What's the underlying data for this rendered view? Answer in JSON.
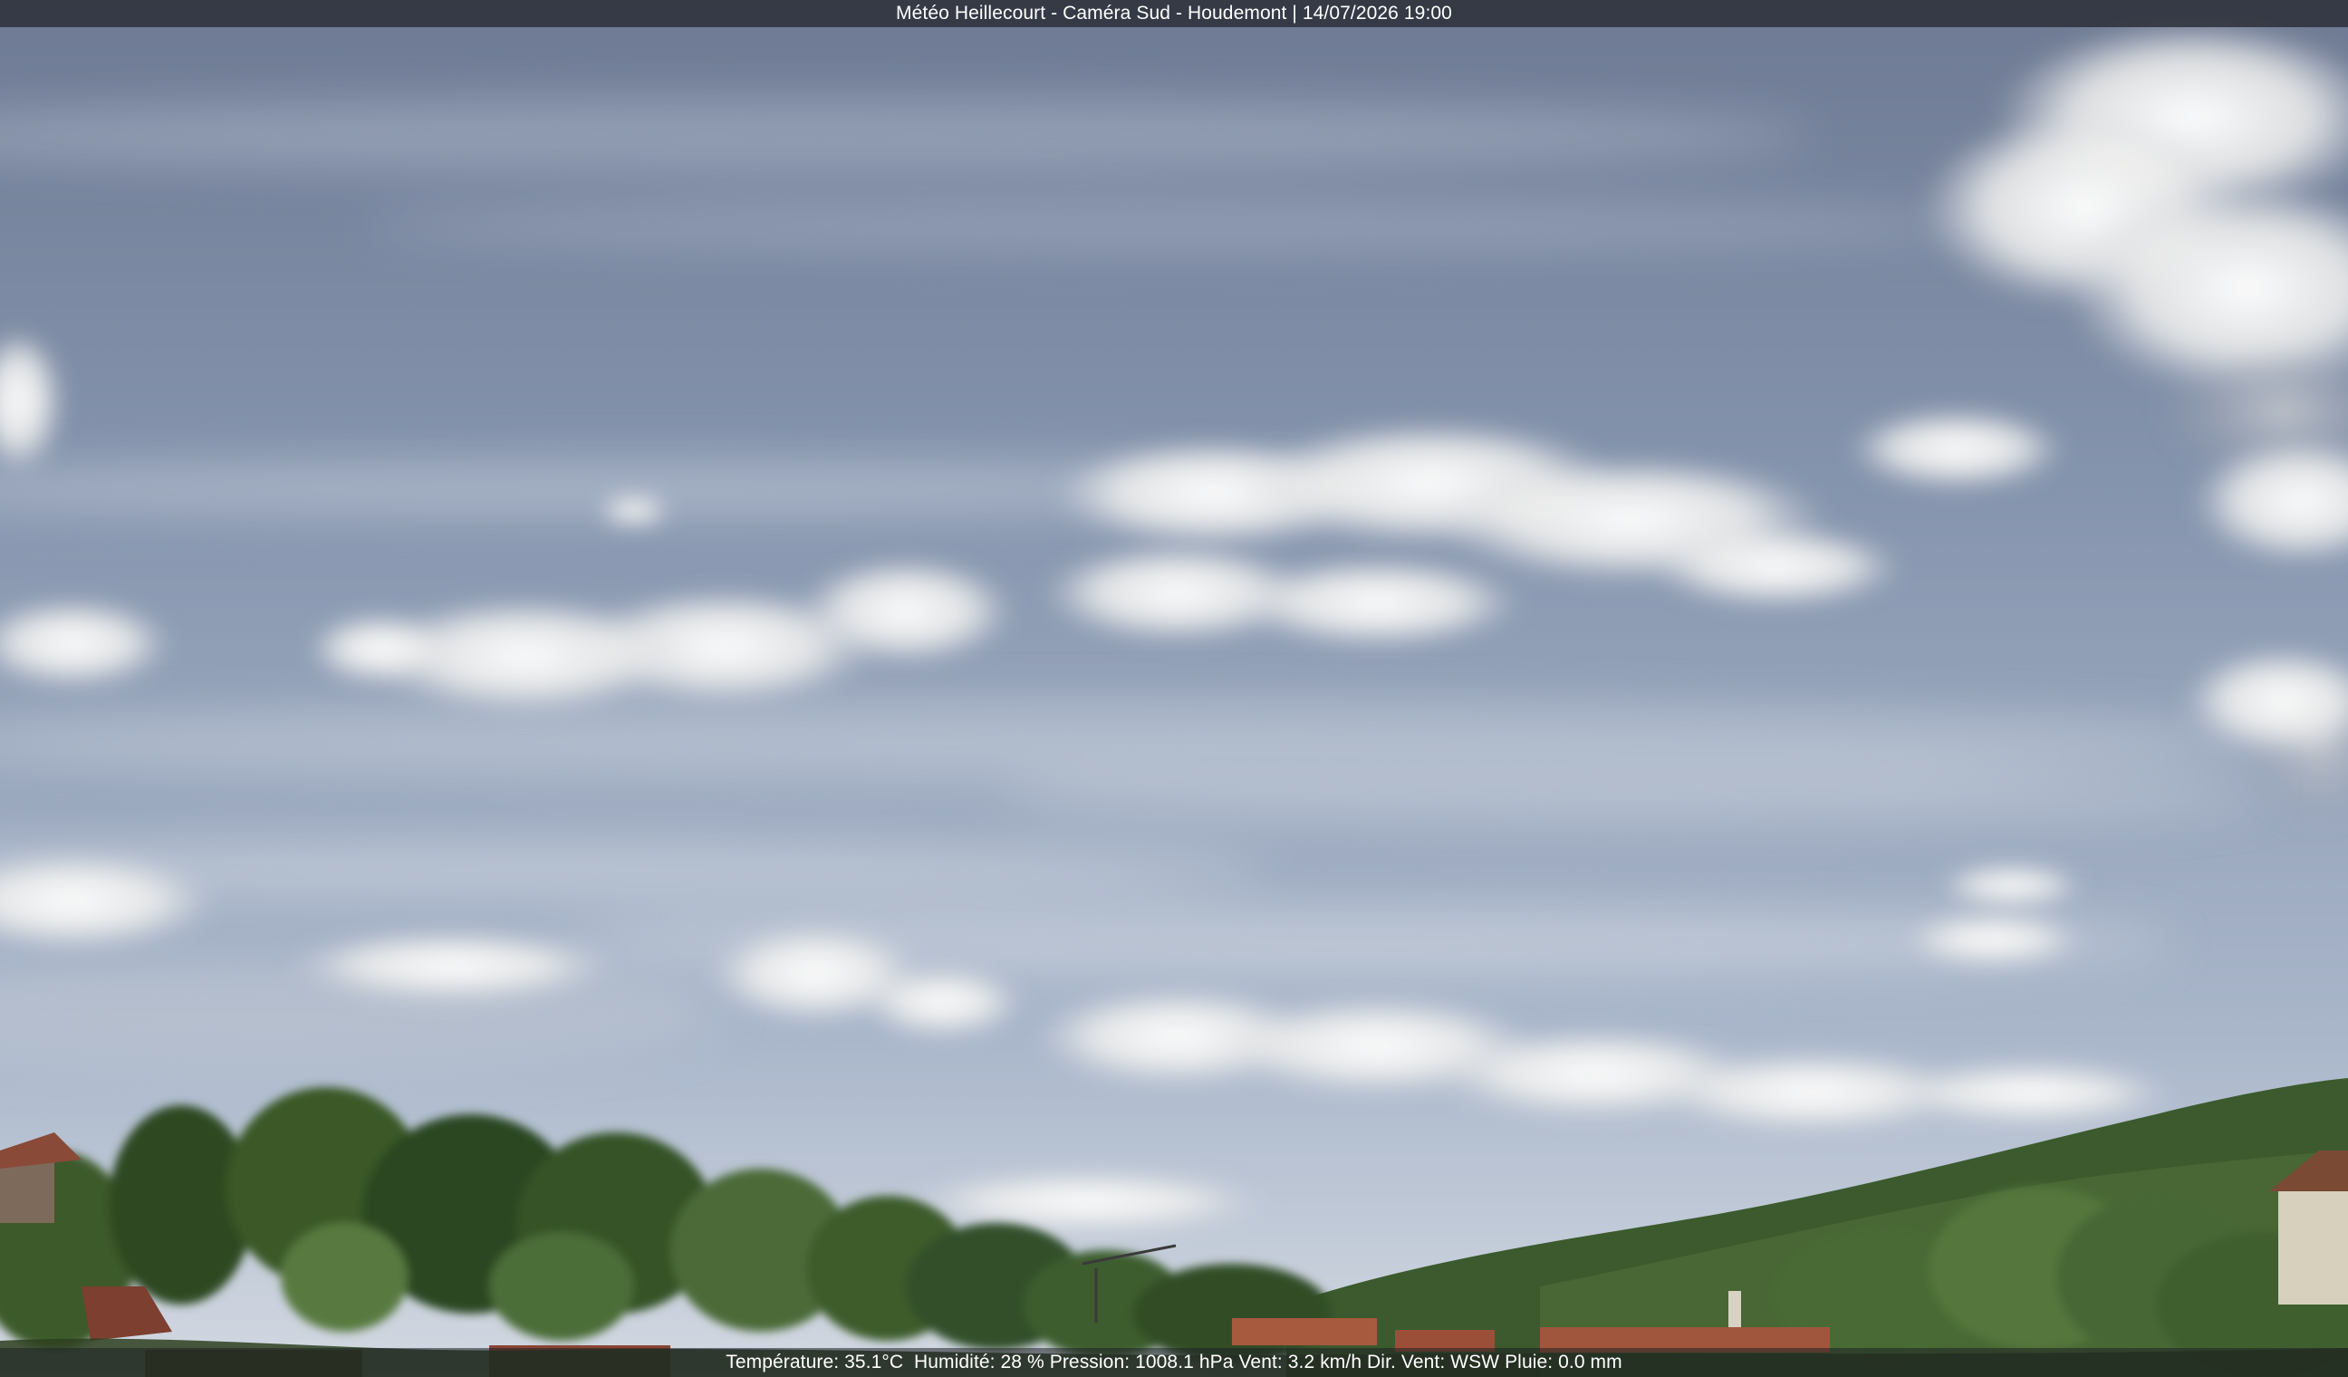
{
  "camera": {
    "title": "Météo Heillecourt - Caméra Sud - Houdemont | 14/07/2026 19:00"
  },
  "weather": {
    "readout": "Température: 35.1°C  Humidité: 28 % Pression: 1008.1 hPa Vent: 3.2 km/h Dir. Vent: WSW Pluie: 0.0 mm"
  },
  "colors": {
    "sky_top": "#6f7b94",
    "sky_mid": "#8e9cb6",
    "sky_horizon": "#c9d2df",
    "cloud": "#f1f1ef",
    "tree_dark": "#2e4a22",
    "tree_light": "#4e6b35",
    "hill": "#3f5a2e",
    "roof": "#a0523a"
  }
}
